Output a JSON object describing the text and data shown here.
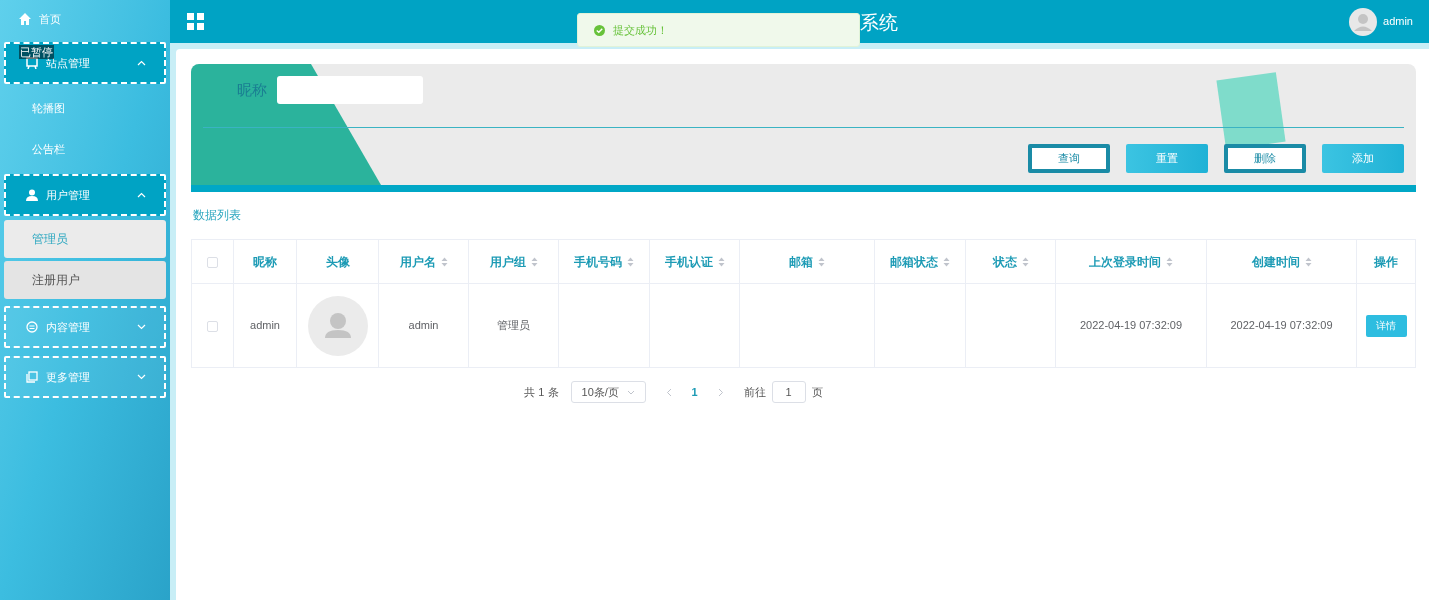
{
  "player_overlay": {
    "label": "已暂停"
  },
  "sidebar": {
    "home": {
      "label": "首页"
    },
    "groups": [
      {
        "label": "站点管理",
        "expanded": true,
        "children": [
          {
            "label": "轮播图",
            "selected": false
          },
          {
            "label": "公告栏",
            "selected": false
          }
        ]
      },
      {
        "label": "用户管理",
        "expanded": true,
        "children": [
          {
            "label": "管理员",
            "selected": true
          },
          {
            "label": "注册用户",
            "selected": false
          }
        ]
      },
      {
        "label": "内容管理",
        "expanded": false
      },
      {
        "label": "更多管理",
        "expanded": false
      }
    ]
  },
  "header": {
    "title": "系统",
    "user": "admin"
  },
  "toast": {
    "message": "提交成功！"
  },
  "search": {
    "label": "昵称",
    "buttons": [
      {
        "label": "查询",
        "kind": "outlined"
      },
      {
        "label": "重置",
        "kind": "filled"
      },
      {
        "label": "删除",
        "kind": "outlined"
      },
      {
        "label": "添加",
        "kind": "filled"
      }
    ]
  },
  "section_title": "数据列表",
  "table": {
    "select_all_checked": false,
    "columns": [
      {
        "label": "昵称",
        "sortable": false
      },
      {
        "label": "头像",
        "sortable": false
      },
      {
        "label": "用户名",
        "sortable": true
      },
      {
        "label": "用户组",
        "sortable": true
      },
      {
        "label": "手机号码",
        "sortable": true
      },
      {
        "label": "手机认证",
        "sortable": true
      },
      {
        "label": "邮箱",
        "sortable": true
      },
      {
        "label": "邮箱状态",
        "sortable": true
      },
      {
        "label": "状态",
        "sortable": true
      },
      {
        "label": "上次登录时间",
        "sortable": true
      },
      {
        "label": "创建时间",
        "sortable": true
      },
      {
        "label": "操作",
        "sortable": false
      }
    ],
    "rows": [
      {
        "checked": false,
        "cells": [
          "admin",
          null,
          "admin",
          "管理员",
          "",
          "",
          "",
          "",
          "",
          "2022-04-19 07:32:09",
          "2022-04-19 07:32:09"
        ],
        "action": "详情"
      }
    ]
  },
  "pagination": {
    "total": "共 1 条",
    "page_size": "10条/页",
    "pages": [
      {
        "label": "1",
        "selected": true
      }
    ],
    "goto_label": "前往",
    "goto_value": "1",
    "goto_suffix": "页"
  }
}
